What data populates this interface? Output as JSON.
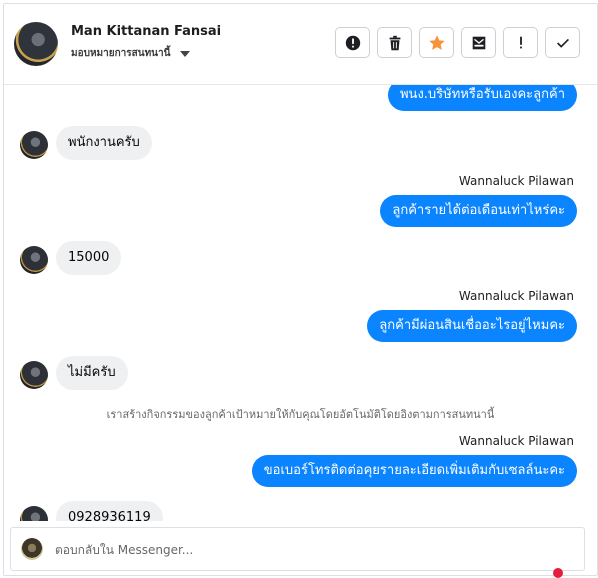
{
  "header": {
    "name": "Man Kittanan Fansai",
    "assign_label": "มอบหมายการสนทนานี้",
    "toolbar": [
      {
        "icon": "info-circle-icon"
      },
      {
        "icon": "trash-icon"
      },
      {
        "icon": "star-icon",
        "color": "#f7923a"
      },
      {
        "icon": "mail-icon"
      },
      {
        "icon": "exclamation-icon"
      },
      {
        "icon": "check-icon"
      }
    ]
  },
  "messages": {
    "m0": {
      "text": "พนง.บริษัทหรือรับเองคะลูกค้า"
    },
    "m1": {
      "text": "พนักงานครับ"
    },
    "m2_sender": "Wannaluck Pilawan",
    "m2": {
      "text": "ลูกค้ารายได้ต่อเดือนเท่าไหร่คะ"
    },
    "m3": {
      "text": "15000"
    },
    "m4_sender": "Wannaluck Pilawan",
    "m4": {
      "text": "ลูกค้ามีผ่อนสินเชื่ออะไรอยู่ไหมคะ"
    },
    "m5": {
      "text": "ไม่มีครับ"
    },
    "system": "เราสร้างกิจกรรมของลูกค้าเป้าหมายให้กับคุณโดยอัตโนมัติโดยอิงตามการสนทนานี้",
    "m6_sender": "Wannaluck Pilawan",
    "m6": {
      "text": "ขอเบอร์โทรติดต่อคุยรายละเอียดเพิ่มเติมกับเซลล์นะคะ"
    },
    "m7": {
      "text": "0928936119"
    }
  },
  "composer": {
    "placeholder": "ตอบกลับใน Messenger..."
  },
  "colors": {
    "outgoing_bubble": "#0b84ff",
    "incoming_bubble": "#eef0f2",
    "star": "#f7923a"
  }
}
